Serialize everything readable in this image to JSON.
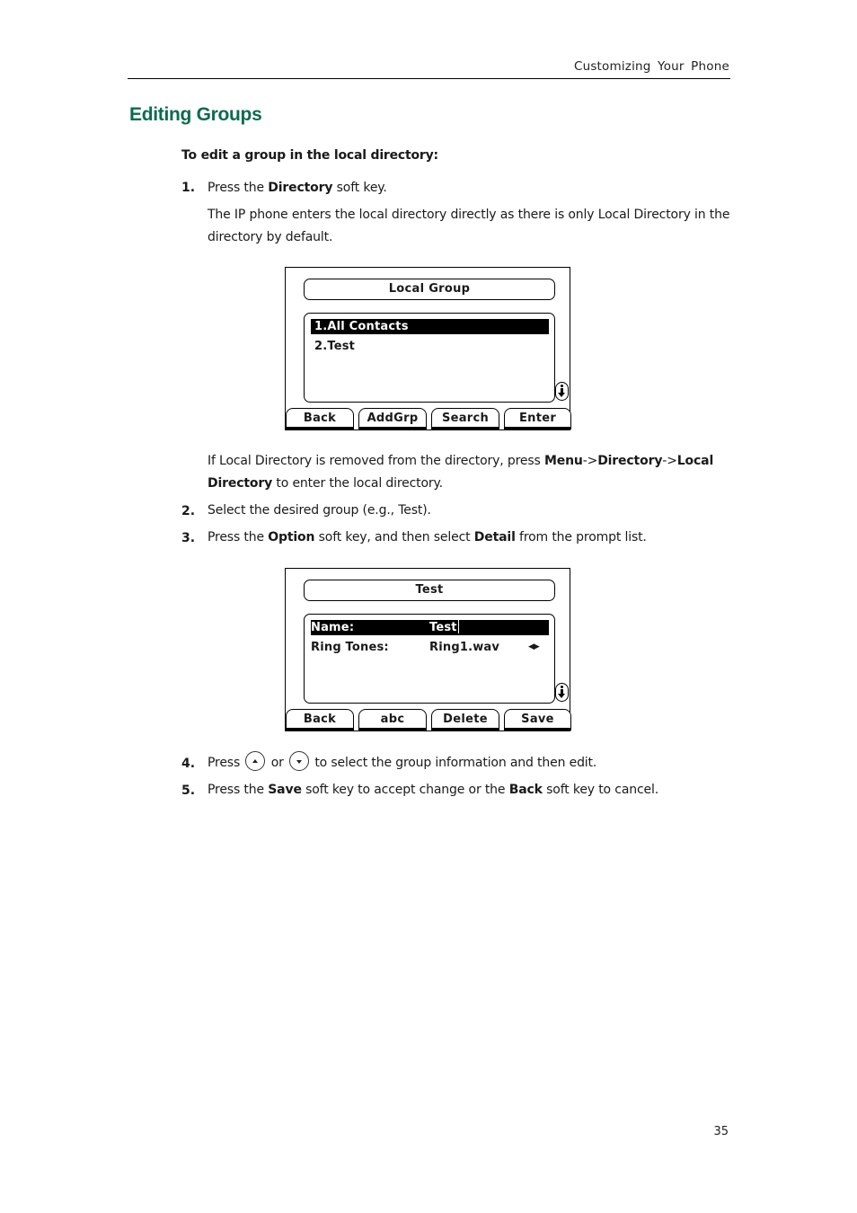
{
  "header": {
    "running_title": "Customizing  Your  Phone"
  },
  "section": {
    "title": "Editing Groups",
    "procedure_title": "To edit a group in the local directory:"
  },
  "steps": [
    {
      "num": "1.",
      "parts": {
        "a": "Press the ",
        "b1": "Directory",
        "c": " soft key."
      },
      "note": "The IP phone enters the local directory directly as there is only Local Directory in the directory by default."
    },
    {
      "num": "2.",
      "text": "Select the desired group (e.g., Test)."
    },
    {
      "num": "3.",
      "parts": {
        "a": "Press the ",
        "b1": "Option",
        "c": " soft key, and then select ",
        "b2": "Detail",
        "d": " from the prompt list."
      }
    },
    {
      "num": "4.",
      "parts": {
        "a": "Press ",
        "or": " or ",
        "c": " to select the group information and then edit."
      },
      "icons": [
        "up-navigation-key",
        "down-navigation-key"
      ]
    },
    {
      "num": "5.",
      "parts": {
        "a": "Press the ",
        "b1": "Save",
        "c": " soft key to accept change or the ",
        "b2": "Back",
        "d": " soft key to cancel."
      }
    }
  ],
  "local_dir_note": {
    "a": "If Local Directory is removed from the directory, press ",
    "b1": "Menu",
    "sep1": "->",
    "b2": "Directory",
    "sep2": "->",
    "b3": "Local Directory",
    "c": " to enter the local directory."
  },
  "screen1": {
    "title": "Local Group",
    "items": [
      {
        "label": "1.All Contacts",
        "selected": true
      },
      {
        "label": "2.Test",
        "selected": false
      }
    ],
    "scroll_icon": "scroll-down-icon",
    "softkeys": [
      "Back",
      "AddGrp",
      "Search",
      "Enter"
    ]
  },
  "screen2": {
    "title": "Test",
    "fields": [
      {
        "label": "Name:",
        "value": "Test",
        "selected": true
      },
      {
        "label": "Ring Tones:",
        "value": "Ring1.wav",
        "arrows": "◀▶",
        "selected": false
      }
    ],
    "scroll_icon": "scroll-down-icon",
    "softkeys": [
      "Back",
      "abc",
      "Delete",
      "Save"
    ]
  },
  "page_number": "35"
}
